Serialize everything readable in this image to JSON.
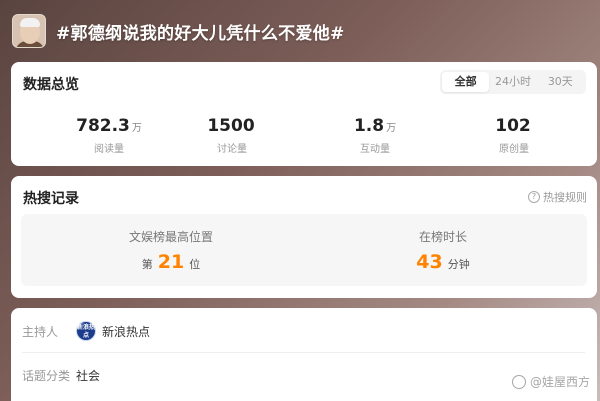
{
  "header": {
    "title": "#郭德纲说我的好大儿凭什么不爱他#"
  },
  "overview": {
    "title": "数据总览",
    "tabs": [
      "全部",
      "24小时",
      "30天"
    ],
    "active_tab": "全部",
    "stats": [
      {
        "value": "782.3",
        "unit": "万",
        "label": "阅读量"
      },
      {
        "value": "1500",
        "unit": "",
        "label": "讨论量"
      },
      {
        "value": "1.8",
        "unit": "万",
        "label": "互动量"
      },
      {
        "value": "102",
        "unit": "",
        "label": "原创量"
      }
    ]
  },
  "hot": {
    "title": "热搜记录",
    "rules_label": "热搜规则",
    "rules_icon": "question-icon",
    "best_position_label": "文娱榜最高位置",
    "best_position_prefix": "第",
    "best_position_value": "21",
    "best_position_suffix": "位",
    "duration_label": "在榜时长",
    "duration_value": "43",
    "duration_unit": "分钟",
    "accent_color": "#ff8200"
  },
  "info": {
    "host_key": "主持人",
    "host_logo_text": "新浪热点",
    "host_name": "新浪热点",
    "category_key": "话题分类",
    "category_value": "社会"
  },
  "watermark": {
    "text": "@娃屋西方"
  }
}
